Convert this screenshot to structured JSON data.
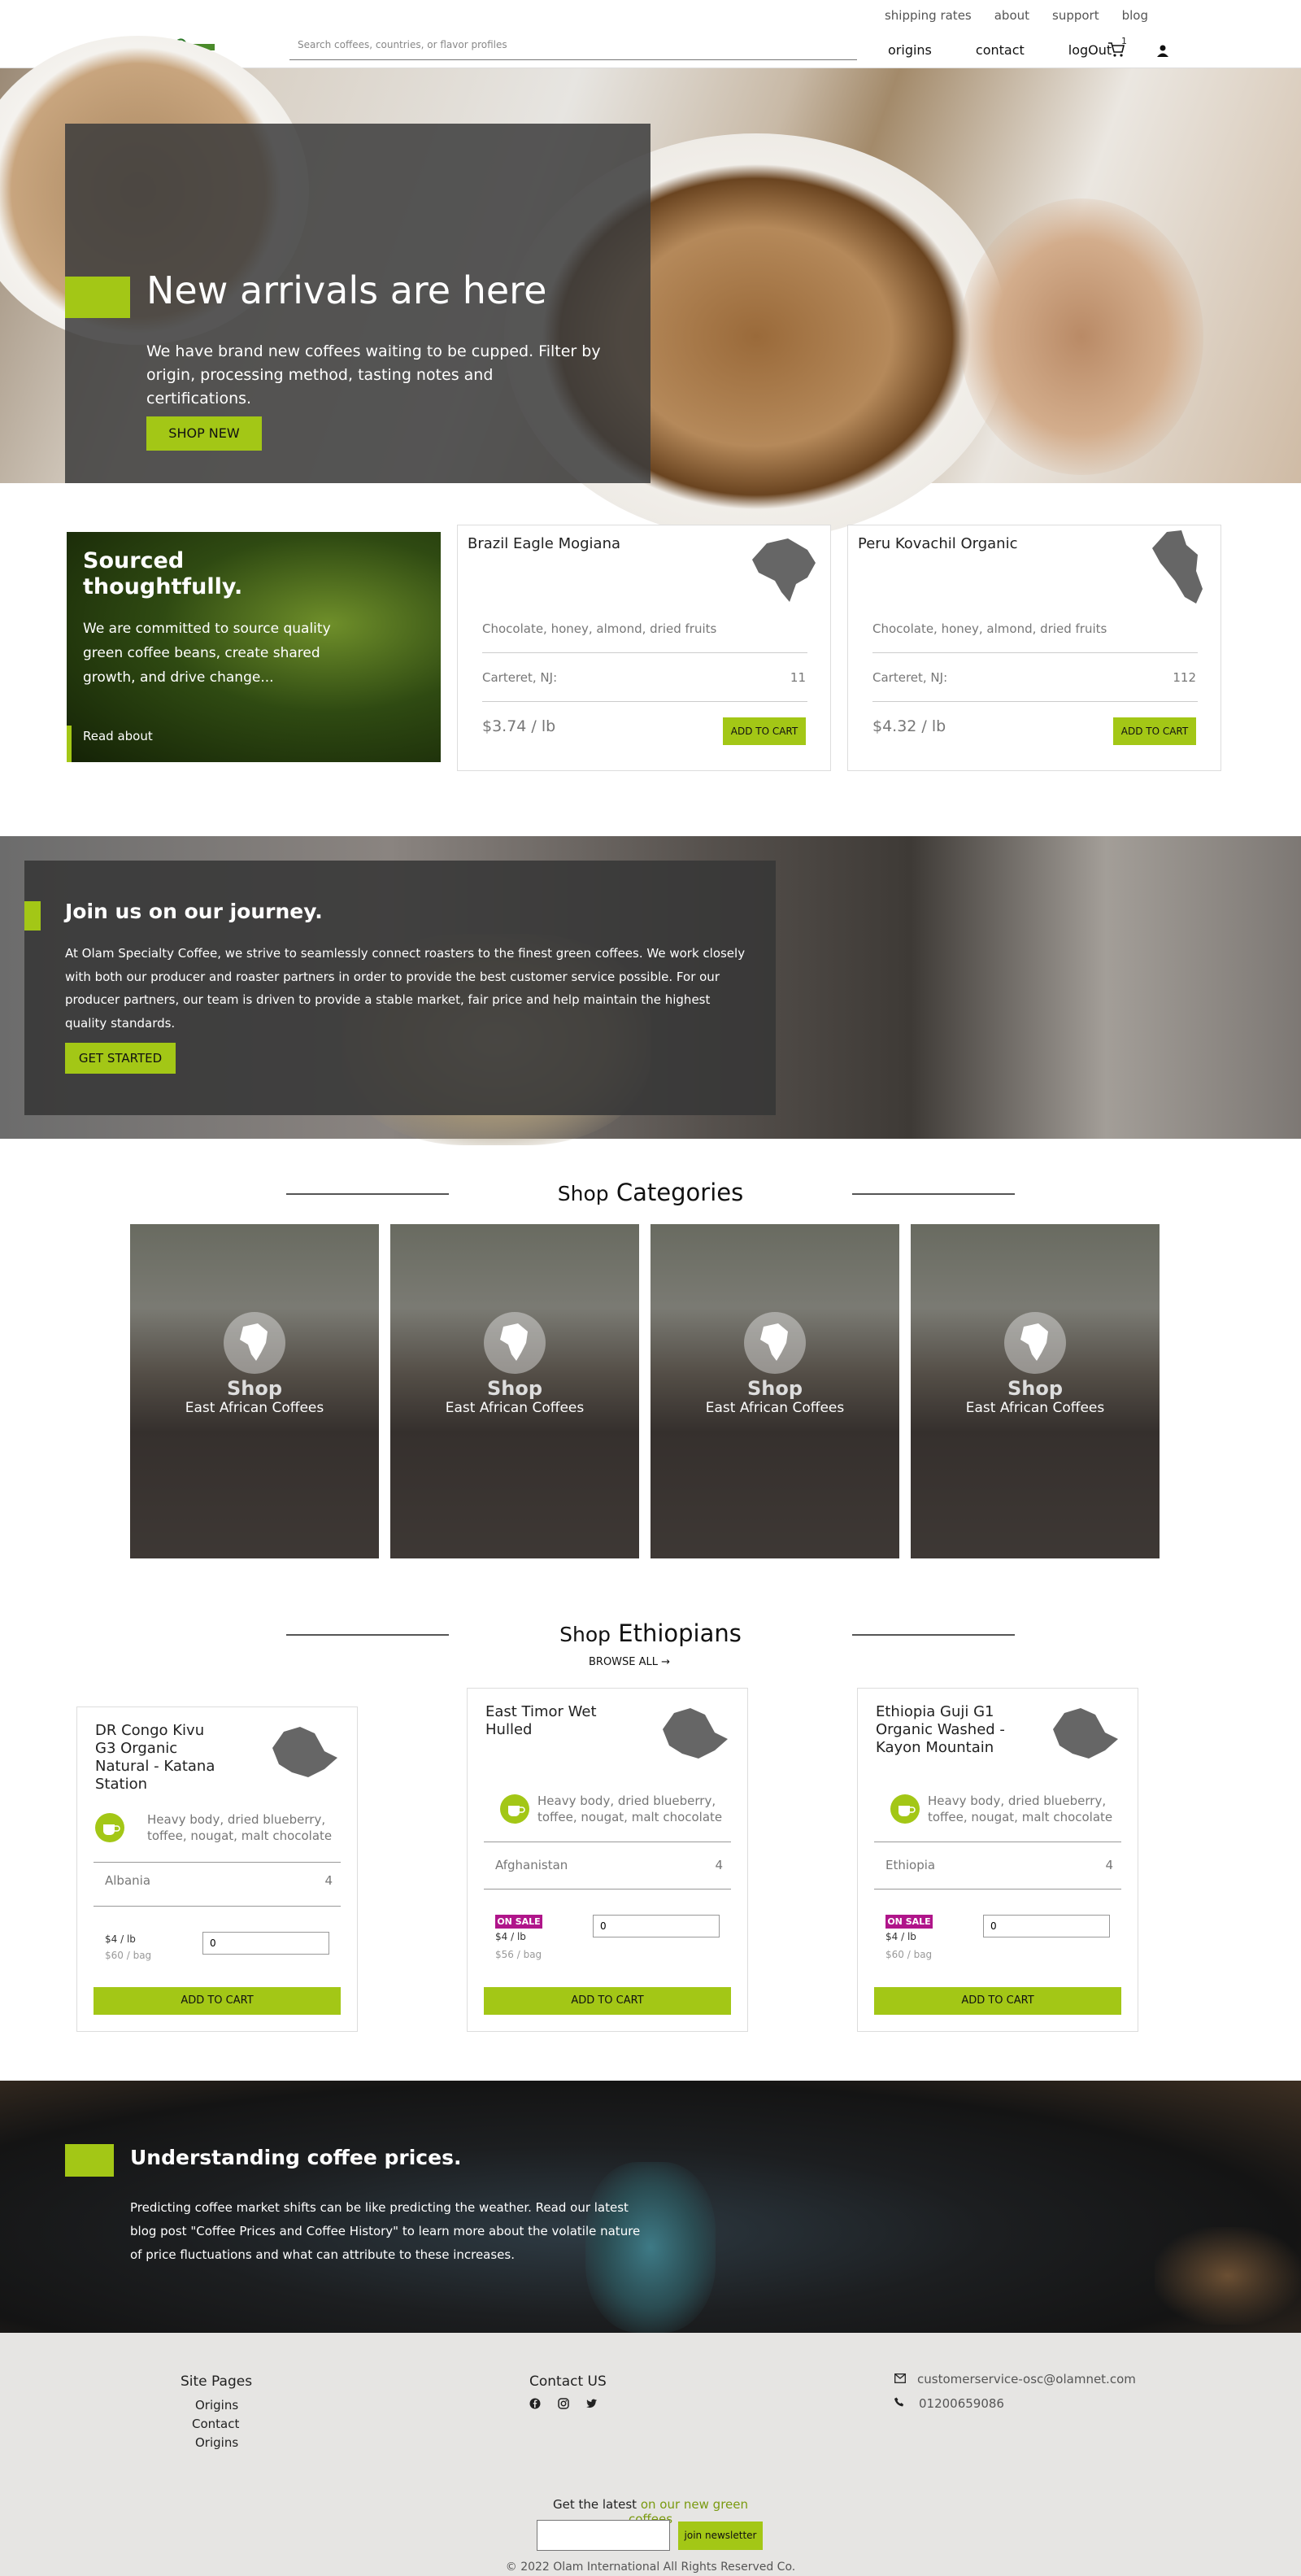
{
  "header": {
    "top_links": [
      "shipping rates",
      "about",
      "support",
      "blog"
    ],
    "search_placeholder": "Search coffees, countries, or flavor profiles",
    "nav": [
      "origins",
      "contact",
      "logOut"
    ],
    "cart_count": "1"
  },
  "hero": {
    "title": "New arrivals are here",
    "text": "We have brand new coffees waiting to be cupped. Filter by origin, processing method, tasting notes and certifications.",
    "button": "SHOP NEW"
  },
  "sourced": {
    "title": "Sourced thoughtfully.",
    "text": "We are committed to source quality green coffee beans, create shared growth, and drive change...",
    "link": "Read about"
  },
  "featured": [
    {
      "name": "Brazil Eagle Mogiana",
      "notes": "Chocolate, honey, almond, dried fruits",
      "location": "Carteret, NJ:",
      "qty": "11",
      "price": "$3.74 / lb",
      "button": "ADD TO CART",
      "icon": "brazil-map-icon"
    },
    {
      "name": "Peru Kovachil Organic",
      "notes": "Chocolate, honey, almond, dried fruits",
      "location": "Carteret, NJ:",
      "qty": "112",
      "price": "$4.32 / lb",
      "button": "ADD TO CART",
      "icon": "peru-map-icon"
    }
  ],
  "journey": {
    "title": "Join us on our journey.",
    "text": "At Olam Specialty Coffee, we strive to seamlessly connect roasters to the finest green coffees. We work closely with both our producer and roaster partners in order to provide the best customer service possible. For our producer partners, our team is driven to provide a stable market, fair price and help maintain the highest quality standards.",
    "button": "GET STARTED"
  },
  "categories": {
    "heading_small": "Shop",
    "heading_large": "Categories",
    "items": [
      {
        "shop": "Shop",
        "label": "East African Coffees"
      },
      {
        "shop": "Shop",
        "label": "East African Coffees"
      },
      {
        "shop": "Shop",
        "label": "East African Coffees"
      },
      {
        "shop": "Shop",
        "label": "East African Coffees"
      }
    ]
  },
  "ethiopians": {
    "heading_small": "Shop",
    "heading_large": "Ethiopians",
    "browse": "BROWSE ALL",
    "items": [
      {
        "name": "DR Congo Kivu G3 Organic Natural - Katana Station",
        "notes": "Heavy body, dried blueberry, toffee, nougat, malt chocolate",
        "location": "Albania",
        "qty": "4",
        "sale": "",
        "price_lb": "$4 / lb",
        "price_bag": "$60 / bag",
        "input": "0",
        "button": "ADD TO CART"
      },
      {
        "name": "East Timor Wet Hulled",
        "notes": "Heavy body, dried blueberry, toffee, nougat, malt chocolate",
        "location": "Afghanistan",
        "qty": "4",
        "sale": "ON SALE",
        "price_lb": "$4 / lb",
        "price_bag": "$56 / bag",
        "input": "0",
        "button": "ADD TO CART"
      },
      {
        "name": "Ethiopia Guji G1 Organic Washed - Kayon Mountain",
        "notes": "Heavy body, dried blueberry, toffee, nougat, malt chocolate",
        "location": "Ethiopia",
        "qty": "4",
        "sale": "ON SALE",
        "price_lb": "$4 / lb",
        "price_bag": "$60 / bag",
        "input": "0",
        "button": "ADD TO CART"
      }
    ]
  },
  "prices": {
    "title": "Understanding coffee prices.",
    "text": "Predicting coffee market shifts can be like predicting the weather. Read our latest blog post \"Coffee Prices and Coffee History\" to learn more about the volatile nature of price fluctuations and what can attribute to these increases."
  },
  "footer": {
    "site_pages_title": "Site Pages",
    "site_pages": [
      "Origins",
      "Contact",
      "Origins"
    ],
    "contact_title": "Contact US",
    "email": "customerservice-osc@olamnet.com",
    "phone": "01200659086",
    "newsletter_lead": "Get the latest",
    "newsletter_tail": " on our new green coffees",
    "newsletter_button": "join newsletter",
    "copyright": "© 2022 Olam International All Rights Reserved Co."
  },
  "colors": {
    "accent": "#a3c716",
    "sale": "#b0158a",
    "footer_bg": "#e6e5e3"
  }
}
